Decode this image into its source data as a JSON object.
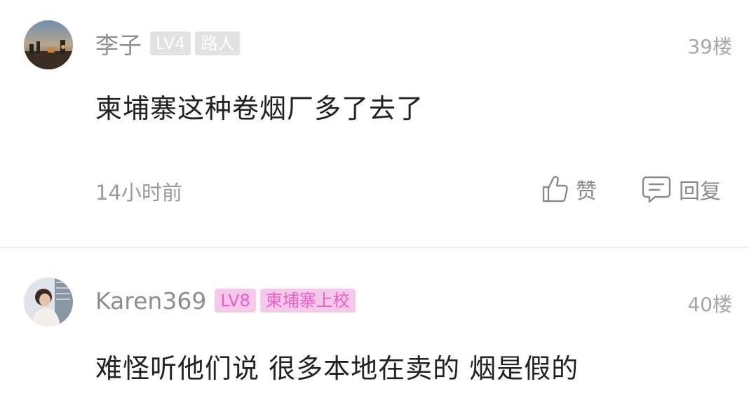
{
  "comments": [
    {
      "username": "李子",
      "level": "LV4",
      "title": "路人",
      "floor": "39楼",
      "content": "柬埔寨这种卷烟厂多了去了",
      "time": "14小时前",
      "like_label": "赞",
      "reply_label": "回复"
    },
    {
      "username": "Karen369",
      "level": "LV8",
      "title": "柬埔寨上校",
      "floor": "40楼",
      "content": "难怪听他们说 很多本地在卖的 烟是假的"
    }
  ],
  "colors": {
    "badge_gray": "#e2e2e2",
    "badge_pink_bg": "#f6c8ea",
    "badge_pink_text": "#ec5fc4"
  }
}
